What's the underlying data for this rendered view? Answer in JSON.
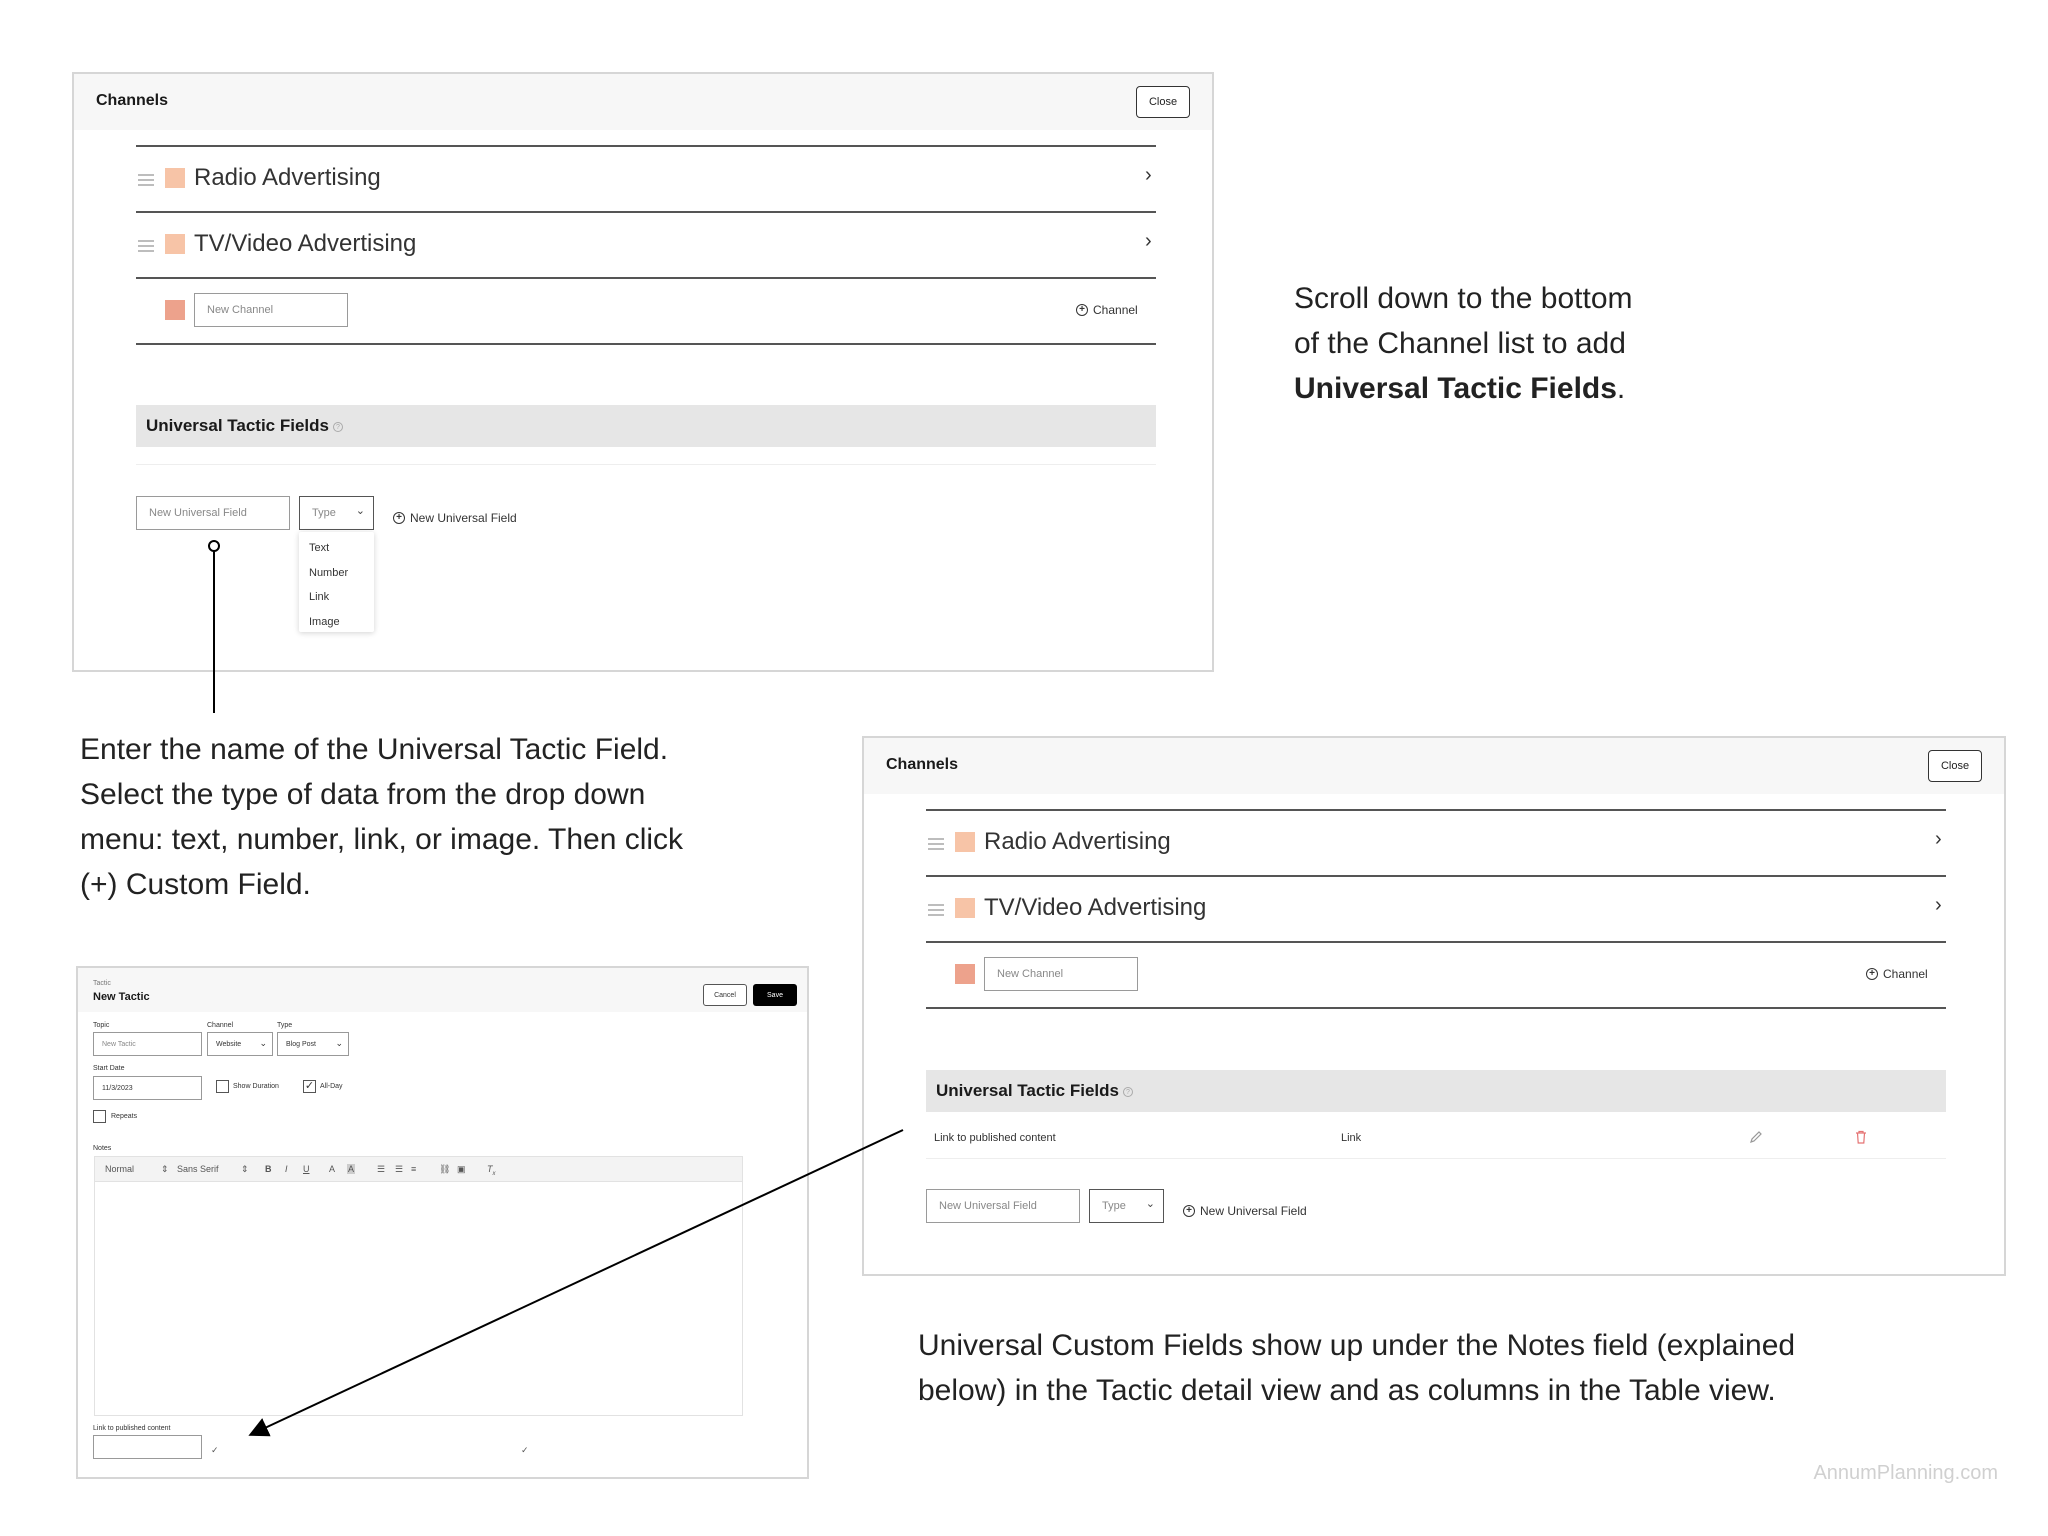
{
  "panel_top": {
    "title": "Channels",
    "close_label": "Close",
    "channels": [
      {
        "label": "Radio Advertising",
        "color": "#f7c4a7"
      },
      {
        "label": "TV/Video Advertising",
        "color": "#f7c4a7"
      }
    ],
    "new_channel_placeholder": "New Channel",
    "new_channel_color": "#eda28c",
    "add_channel_label": "Channel",
    "utf_title": "Universal Tactic Fields",
    "new_field_placeholder": "New Universal Field",
    "type_label": "Type",
    "add_field_label": "New Universal Field",
    "type_options": [
      "Text",
      "Number",
      "Link",
      "Image"
    ]
  },
  "panel_bottom": {
    "title": "Channels",
    "close_label": "Close",
    "channels": [
      {
        "label": "Radio Advertising",
        "color": "#f7c4a7"
      },
      {
        "label": "TV/Video Advertising",
        "color": "#f7c4a7"
      }
    ],
    "new_channel_placeholder": "New Channel",
    "new_channel_color": "#eda28c",
    "add_channel_label": "Channel",
    "utf_title": "Universal Tactic Fields",
    "field_row": {
      "name": "Link to published content",
      "type": "Link"
    },
    "new_field_placeholder": "New Universal Field",
    "type_label": "Type",
    "add_field_label": "New Universal Field"
  },
  "notes": {
    "scroll_line1": "Scroll down to the bottom",
    "scroll_line2": "of the Channel list to add",
    "scroll_bold": "Universal Tactic Fields",
    "scroll_end": ".",
    "enter_line1": "Enter the name of the Universal Tactic Field.",
    "enter_line2": "Select the type of data from the drop down",
    "enter_line3": "menu: text, number, link, or image. Then click",
    "enter_line4": "(+) Custom Field.",
    "universal_line1": "Universal Custom Fields show up under the Notes field (explained",
    "universal_line2": "below) in the Tactic detail view and as columns in the Table view."
  },
  "tactic": {
    "kicker": "Tactic",
    "title": "New Tactic",
    "cancel_label": "Cancel",
    "save_label": "Save",
    "topic_label": "Topic",
    "topic_placeholder": "New Tactic",
    "channel_label": "Channel",
    "channel_value": "Website",
    "type_label": "Type",
    "type_value": "Blog Post",
    "start_date_label": "Start Date",
    "start_date_value": "11/3/2023",
    "show_duration_label": "Show Duration",
    "all_day_label": "All-Day",
    "repeats_label": "Repeats",
    "notes_label": "Notes",
    "toolbar_format": "Normal",
    "toolbar_font": "Sans Serif",
    "custom_field_label": "Link to published content"
  },
  "watermark": "AnnumPlanning.com"
}
